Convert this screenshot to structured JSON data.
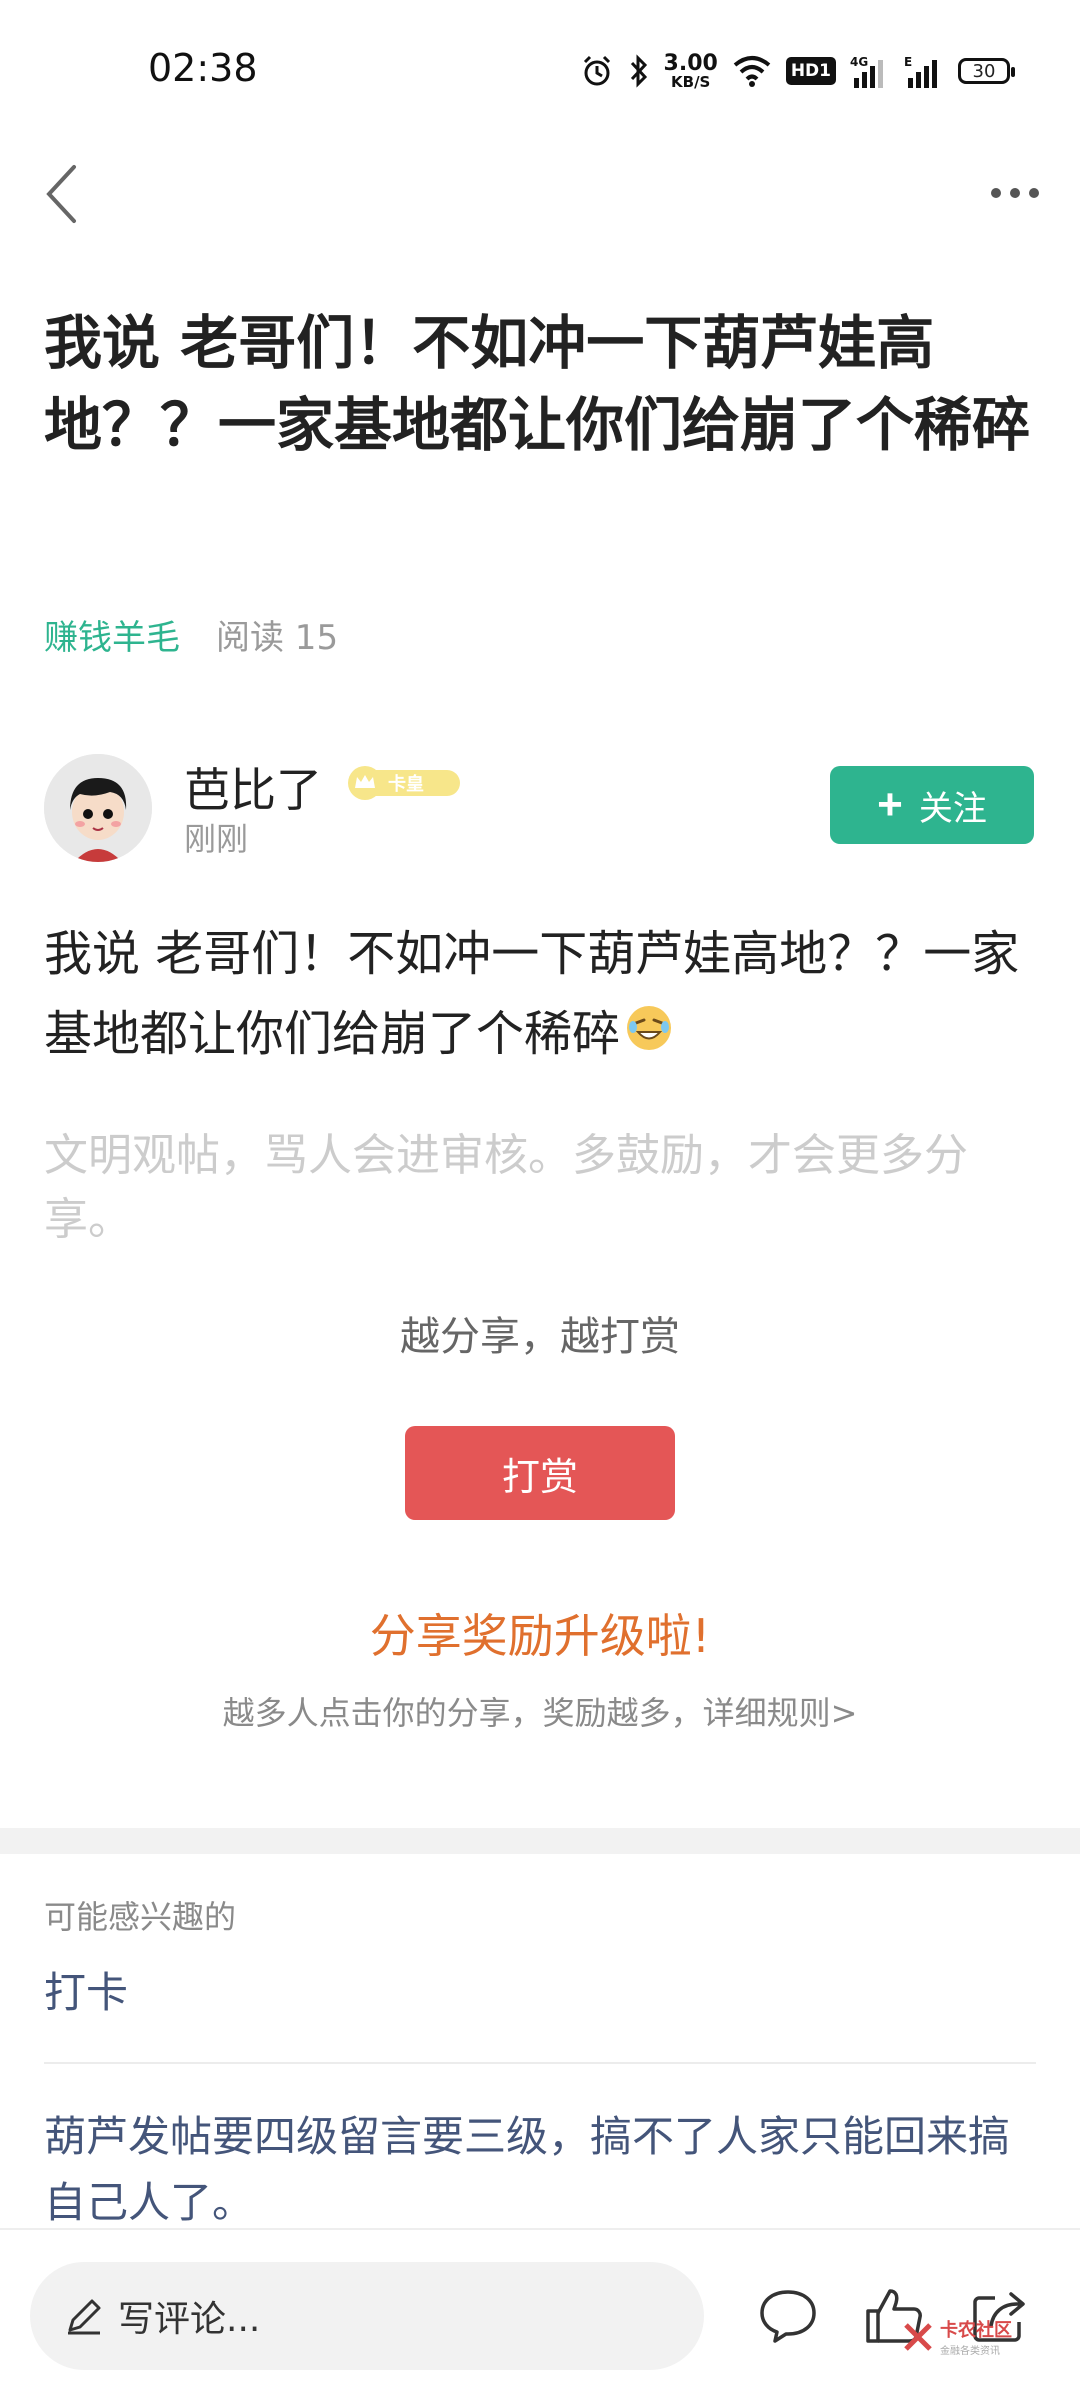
{
  "status_bar": {
    "time": "02:38",
    "net_speed_value": "3.00",
    "net_speed_unit": "KB/S",
    "hd_label": "HD1",
    "network_4g": "4G",
    "network_e": "E",
    "battery_level": "30",
    "icons": [
      "alarm-icon",
      "bluetooth-icon",
      "wifi-icon",
      "signal-icon",
      "battery-icon"
    ]
  },
  "nav": {
    "back_icon": "chevron-left-icon",
    "more_icon": "more-dots-icon"
  },
  "post": {
    "title": "我说 老哥们！不如冲一下葫芦娃高地？？一家基地都让你们给崩了个稀碎",
    "category": "赚钱羊毛",
    "read_count": "阅读 15",
    "author": {
      "name": "芭比了",
      "badge": "卡皇",
      "time": "刚刚",
      "follow_label": "关注"
    },
    "body": "我说  老哥们！不如冲一下葫芦娃高地？？一家基地都让你们给崩了个稀碎",
    "notice": "文明观帖，骂人会进审核。多鼓励，才会更多分享。"
  },
  "reward": {
    "tip": "越分享，越打赏",
    "button_label": "打赏"
  },
  "share_promo": {
    "title": "分享奖励升级啦!",
    "description": "越多人点击你的分享，奖励越多，详细规则>"
  },
  "interest": {
    "label": "可能感兴趣的",
    "items": [
      "打卡",
      "葫芦发帖要四级留言要三级，搞不了人家只能回来搞自己人了。"
    ]
  },
  "bottom_bar": {
    "comment_placeholder": "写评论...",
    "watermark_name": "卡农社区",
    "watermark_sub": "金融各类资讯"
  },
  "colors": {
    "accent_green": "#2eb48f",
    "reward_red": "#e45656",
    "promo_orange": "#e0702e",
    "link_blue": "#44557a"
  }
}
